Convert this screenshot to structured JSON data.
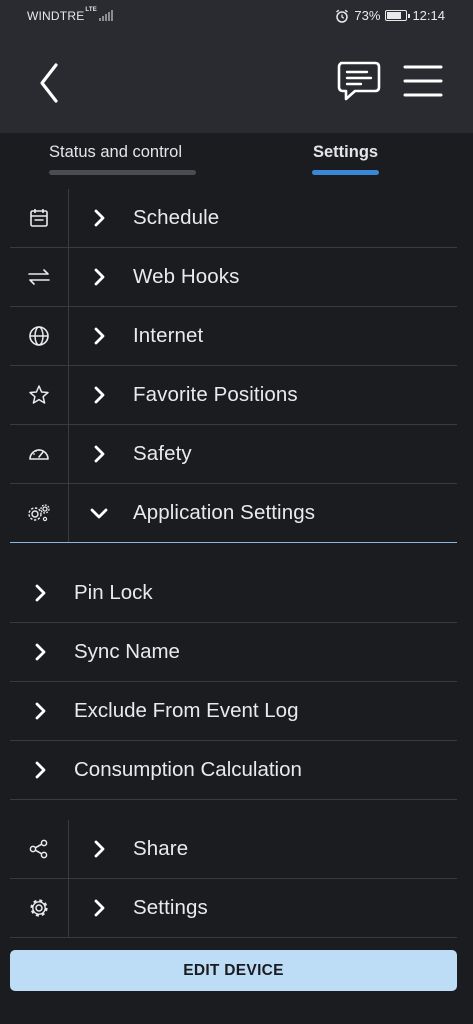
{
  "status_bar": {
    "carrier": "WINDTRE",
    "network": "LTE",
    "battery_percent": "73%",
    "time": "12:14",
    "battery_level": 0.73
  },
  "header": {
    "icons": [
      "back-arrow-icon",
      "chat-icon",
      "hamburger-menu-icon"
    ]
  },
  "tabs": [
    {
      "label": "Status and control",
      "active": false
    },
    {
      "label": "Settings",
      "active": true
    }
  ],
  "menu": {
    "items": [
      {
        "label": "Schedule",
        "icon": "calendar-icon"
      },
      {
        "label": "Web Hooks",
        "icon": "swap-arrows-icon"
      },
      {
        "label": "Internet",
        "icon": "globe-icon"
      },
      {
        "label": "Favorite Positions",
        "icon": "star-icon"
      },
      {
        "label": "Safety",
        "icon": "gauge-icon"
      },
      {
        "label": "Application Settings",
        "icon": "gears-icon",
        "expanded": true
      }
    ],
    "sub_items": [
      {
        "label": "Pin Lock"
      },
      {
        "label": "Sync Name"
      },
      {
        "label": "Exclude From Event Log"
      },
      {
        "label": "Consumption Calculation"
      }
    ],
    "bottom_items": [
      {
        "label": "Share",
        "icon": "share-icon"
      },
      {
        "label": "Settings",
        "icon": "gear-icon"
      }
    ]
  },
  "edit_button": {
    "label": "EDIT DEVICE"
  },
  "colors": {
    "background": "#1b1c20",
    "header": "#2a2b30",
    "accent": "#3b87d6",
    "button": "#bddcf5"
  }
}
